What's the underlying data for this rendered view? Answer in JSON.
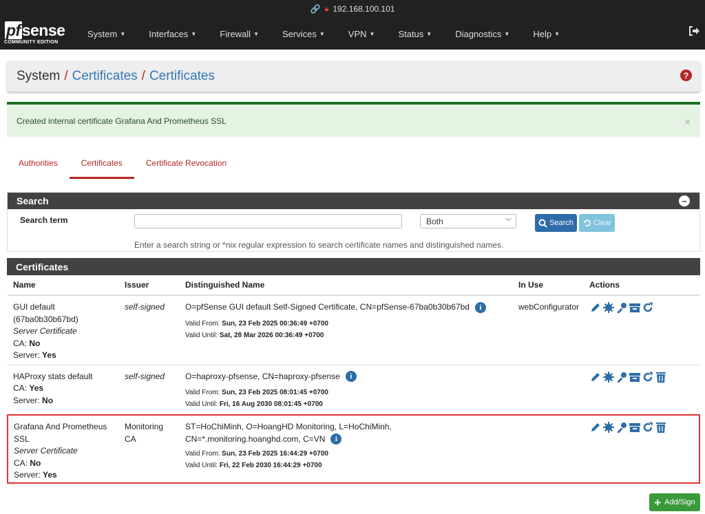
{
  "browser": {
    "url": "192.168.100.101"
  },
  "brand": {
    "logo_text": "pfsense",
    "edition": "COMMUNITY EDITION"
  },
  "nav": {
    "items": [
      {
        "label": "System"
      },
      {
        "label": "Interfaces"
      },
      {
        "label": "Firewall"
      },
      {
        "label": "Services"
      },
      {
        "label": "VPN"
      },
      {
        "label": "Status"
      },
      {
        "label": "Diagnostics"
      },
      {
        "label": "Help"
      }
    ]
  },
  "breadcrumb": {
    "parts": [
      "System",
      "Certificates",
      "Certificates"
    ],
    "separator": "/"
  },
  "alert": {
    "message": "Created internal certificate Grafana And Prometheus SSL",
    "close": "×"
  },
  "tabs": [
    {
      "label": "Authorities",
      "active": false
    },
    {
      "label": "Certificates",
      "active": true
    },
    {
      "label": "Certificate Revocation",
      "active": false
    }
  ],
  "search": {
    "title": "Search",
    "term_label": "Search term",
    "input_value": "",
    "select_value": "Both",
    "search_button": "Search",
    "clear_button": "Clear",
    "help": "Enter a search string or *nix regular expression to search certificate names and distinguished names."
  },
  "certificates": {
    "title": "Certificates",
    "columns": [
      "Name",
      "Issuer",
      "Distinguished Name",
      "In Use",
      "Actions"
    ],
    "rows": [
      {
        "name_line1": "GUI default",
        "name_line2": "(67ba0b30b67bd)",
        "type": "Server Certificate",
        "ca_label": "CA:",
        "ca_value": "No",
        "server_label": "Server:",
        "server_value": "Yes",
        "issuer": "self-signed",
        "dn_line1": "O=pfSense GUI default Self-Signed Certificate, CN=pfSense-67ba0b30b67bd",
        "dn_line2": "",
        "valid_from_label": "Valid From:",
        "valid_from": "Sun, 23 Feb 2025 00:36:49 +0700",
        "valid_until_label": "Valid Until:",
        "valid_until": "Sat, 28 Mar 2026 00:36:49 +0700",
        "in_use": "webConfigurator"
      },
      {
        "name_line1": "HAProxy stats default",
        "ca_label": "CA:",
        "ca_value": "Yes",
        "server_label": "Server:",
        "server_value": "No",
        "issuer": "self-signed",
        "dn_line1": "O=haproxy-pfsense, CN=haproxy-pfsense",
        "valid_from_label": "Valid From:",
        "valid_from": "Sun, 23 Feb 2025 08:01:45 +0700",
        "valid_until_label": "Valid Until:",
        "valid_until": "Fri, 16 Aug 2030 08:01:45 +0700",
        "in_use": ""
      },
      {
        "name_line1": "Grafana And Prometheus",
        "name_line2": "SSL",
        "type": "Server Certificate",
        "ca_label": "CA:",
        "ca_value": "No",
        "server_label": "Server:",
        "server_value": "Yes",
        "issuer_line1": "Monitoring",
        "issuer_line2": "CA",
        "dn_line1": "ST=HoChiMinh, O=HoangHD Monitoring, L=HoChiMinh,",
        "dn_line2": "CN=*.monitoring.hoanghd.com, C=VN",
        "valid_from_label": "Valid From:",
        "valid_from": "Sun, 23 Feb 2025 16:44:29 +0700",
        "valid_until_label": "Valid Until:",
        "valid_until": "Fri, 22 Feb 2030 16:44:29 +0700",
        "in_use": ""
      }
    ]
  },
  "add_button": "Add/Sign",
  "colors": {
    "accent_red": "#b52626",
    "link_blue": "#3278b5",
    "action_blue": "#2d6ca8",
    "success_green": "#3a9a3a"
  }
}
